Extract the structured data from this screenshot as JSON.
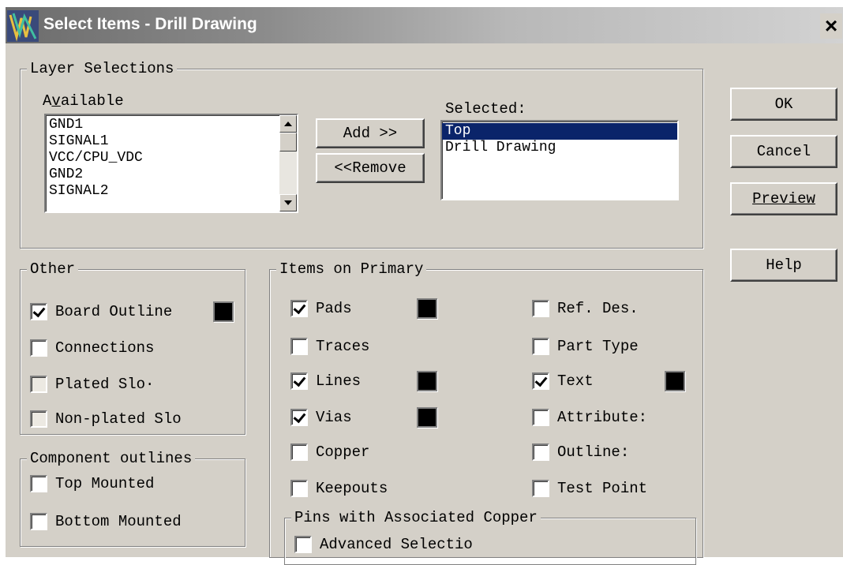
{
  "window": {
    "title": "Select Items - Drill Drawing",
    "close_label": "×"
  },
  "layer_selections": {
    "legend": "Layer Selections",
    "available_label": "Available",
    "available_items": [
      "GND1",
      "SIGNAL1",
      "VCC/CPU_VDC",
      "GND2",
      "SIGNAL2"
    ],
    "selected_label": "Selected:",
    "selected_items": [
      "Top",
      "Drill Drawing"
    ],
    "add_label": "Add >>",
    "remove_label": "<<Remove"
  },
  "buttons": {
    "ok": "OK",
    "cancel": "Cancel",
    "preview": "Preview",
    "help": "Help"
  },
  "other": {
    "legend": "Other",
    "board_outline": "Board Outline",
    "connections": "Connections",
    "plated_slots": "Plated Slo·",
    "non_plated_slots": "Non-plated Slo"
  },
  "component_outlines": {
    "legend": "Component outlines",
    "top_mounted": "Top Mounted",
    "bottom_mounted": "Bottom Mounted"
  },
  "items_on_primary": {
    "legend": "Items on Primary",
    "pads": "Pads",
    "traces": "Traces",
    "lines": "Lines",
    "vias": "Vias",
    "copper": "Copper",
    "keepouts": "Keepouts",
    "ref_des": "Ref. Des.",
    "part_type": "Part Type",
    "text": "Text",
    "attributes": "Attribute:",
    "outlines": "Outline:",
    "test_point": "Test Point"
  },
  "pins_with_copper": {
    "legend": "Pins with Associated Copper",
    "advanced_selection": "Advanced Selectio"
  },
  "colors": {
    "dialog_bg": "#d4d0c8",
    "selection": "#0a246a",
    "swatch": "#000000"
  }
}
